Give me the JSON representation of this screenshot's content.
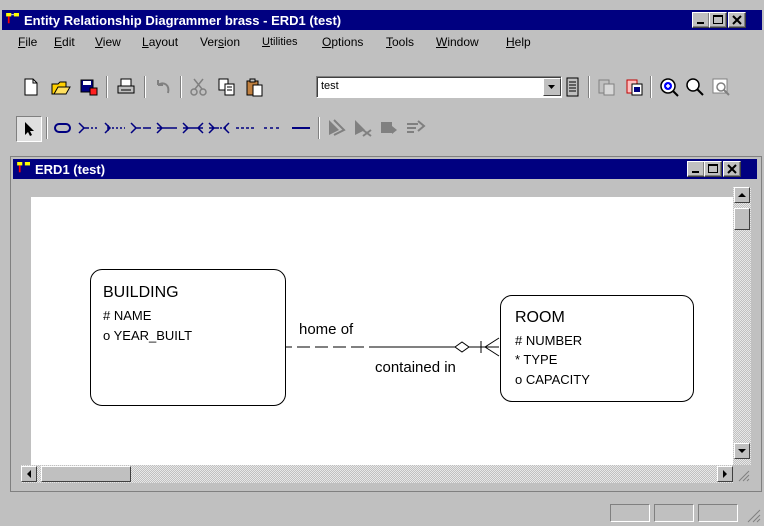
{
  "app": {
    "title": "Entity Relationship Diagrammer brass - ERD1 (test)"
  },
  "menu": {
    "items": [
      {
        "label": "File",
        "ul": "F",
        "rest": "ile"
      },
      {
        "label": "Edit",
        "ul": "E",
        "rest": "dit"
      },
      {
        "label": "View",
        "ul": "V",
        "rest": "iew"
      },
      {
        "label": "Layout",
        "ul": "L",
        "rest": "ayout"
      },
      {
        "label": "Version",
        "pre": "Ver",
        "ul": "s",
        "rest": "ion"
      },
      {
        "label": "Utilities",
        "ul": "U",
        "rest": "tilities"
      },
      {
        "label": "Options",
        "ul": "O",
        "rest": "ptions"
      },
      {
        "label": "Tools",
        "ul": "T",
        "rest": "ools"
      },
      {
        "label": "Window",
        "ul": "W",
        "rest": "indow"
      },
      {
        "label": "Help",
        "ul": "H",
        "rest": "elp"
      }
    ]
  },
  "toolbar": {
    "app_combo_value": "test",
    "icons": [
      "new-icon",
      "open-icon",
      "save-icon",
      "print-icon",
      "undo-icon",
      "cut-icon",
      "copy-icon",
      "paste-icon",
      "list-icon",
      "repository-icon",
      "repository-report-icon",
      "zoom-in-icon",
      "zoom-out-icon",
      "zoom-fit-icon"
    ]
  },
  "palette": {
    "tools": [
      "select-tool-icon",
      "entity-tool-icon",
      "rel-optional-many-icon",
      "rel-optional-many-2-icon",
      "rel-many-optional-icon",
      "rel-many-mandatory-icon",
      "rel-many-many-icon",
      "rel-many-many-optional-icon",
      "rel-optional-optional-icon",
      "rel-optional-dashed-icon",
      "rel-mandatory-icon",
      "arc-icon",
      "arc-remove-icon",
      "arc-add-icon",
      "arc-relation-icon"
    ]
  },
  "child_window": {
    "title": "ERD1 (test)"
  },
  "diagram": {
    "entities": [
      {
        "name": "BUILDING",
        "attributes": [
          "# NAME",
          "o YEAR_BUILT"
        ]
      },
      {
        "name": "ROOM",
        "attributes": [
          "# NUMBER",
          "* TYPE",
          "o CAPACITY"
        ]
      }
    ],
    "relationship": {
      "from_label": "home of",
      "to_label": "contained in"
    }
  },
  "colors": {
    "titlebar": "#000080",
    "face": "#c0c0c0",
    "canvas": "#ffffff"
  }
}
